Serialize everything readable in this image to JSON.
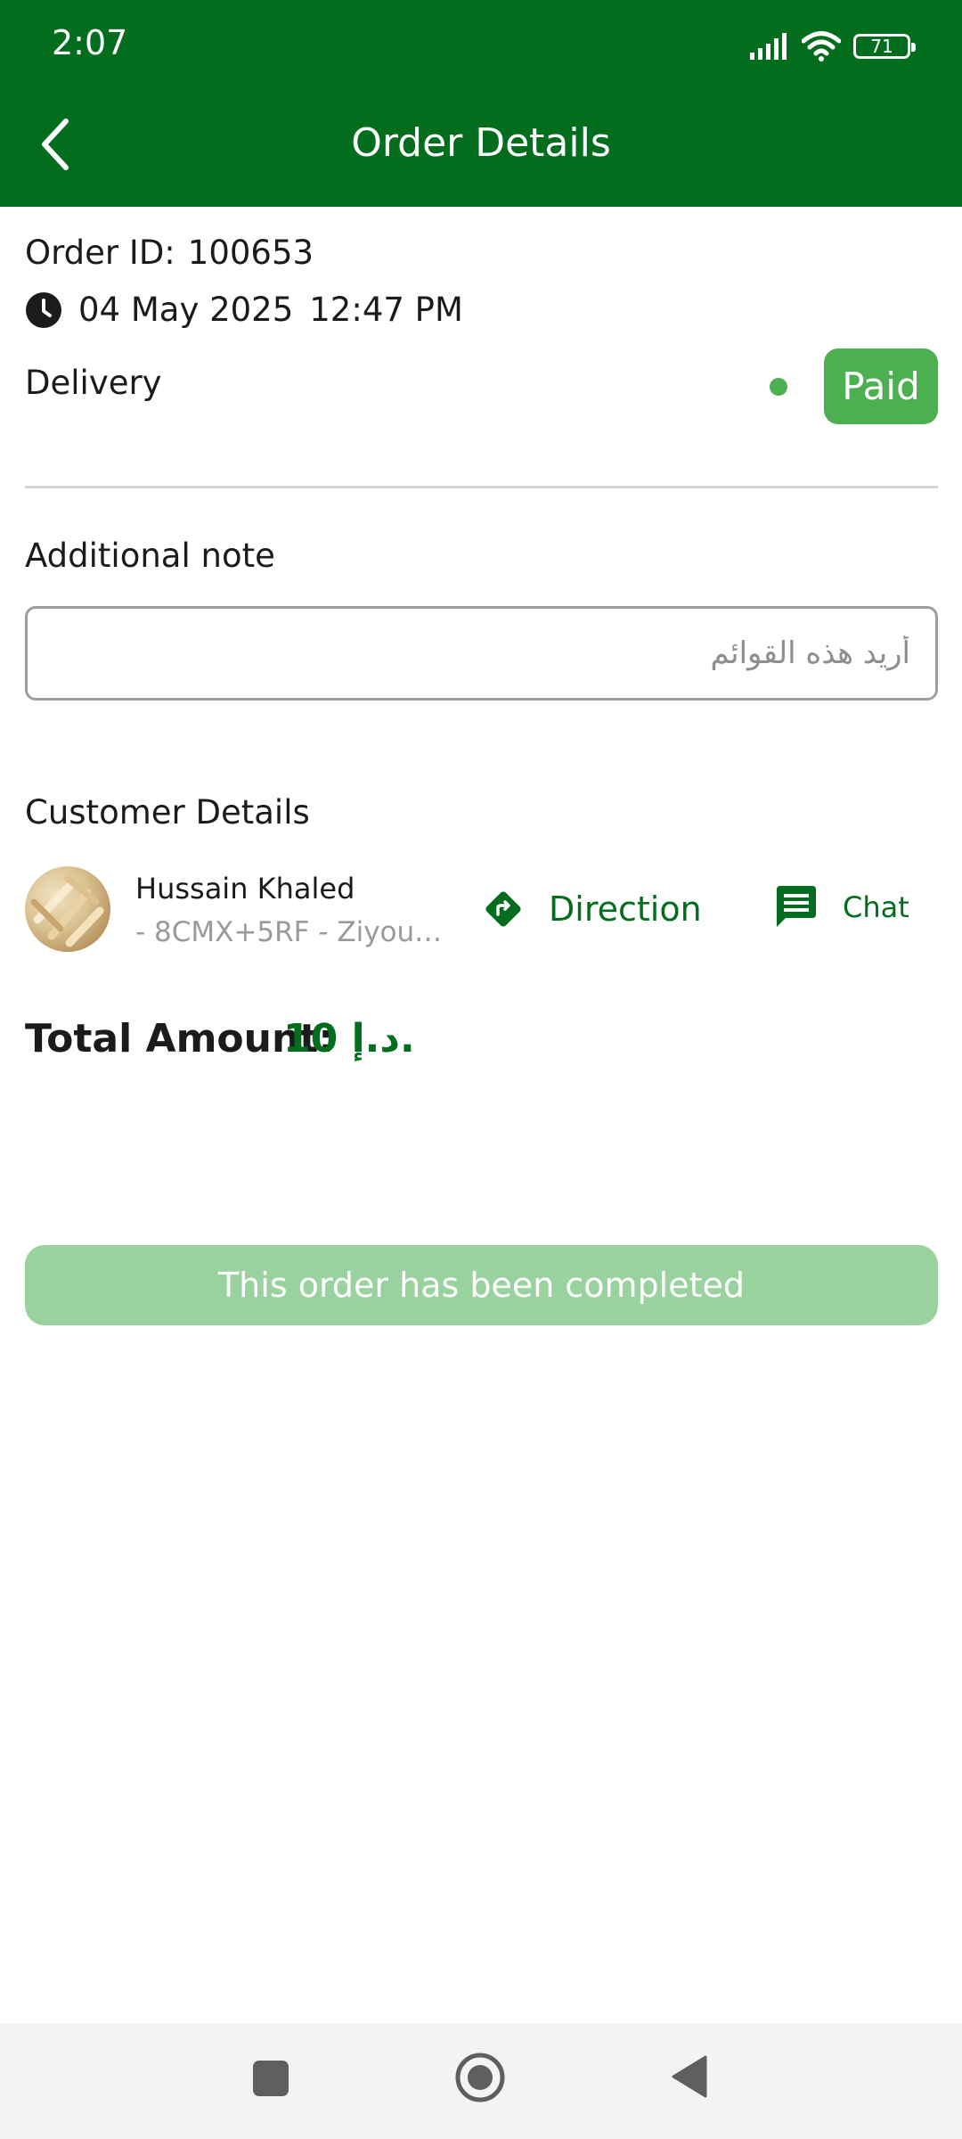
{
  "status_bar": {
    "time": "2:07",
    "battery": "71"
  },
  "header": {
    "title": "Order Details",
    "back_icon": "chevron-left-icon"
  },
  "order": {
    "id_label": "Order ID:",
    "id_value": "100653",
    "date": "04 May 2025",
    "time": "12:47 PM",
    "type": "Delivery",
    "payment_status": "Paid"
  },
  "note": {
    "label": "Additional note",
    "placeholder": "أريد هذه القوائم",
    "value": ""
  },
  "customer": {
    "section_label": "Customer Details",
    "name": "Hussain Khaled",
    "address": "- 8CMX+5RF - Ziyouna...",
    "direction_label": "Direction",
    "chat_label": "Chat"
  },
  "total": {
    "label": "Total Amount:",
    "value": "10 د.إ."
  },
  "completed_message": "This order has been completed",
  "colors": {
    "primary": "#036d1e",
    "paid": "#4caf50",
    "completed": "#9ad29f"
  }
}
